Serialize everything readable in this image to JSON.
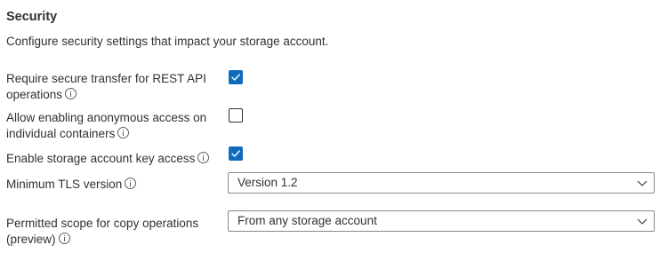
{
  "section": {
    "title": "Security",
    "description": "Configure security settings that impact your storage account."
  },
  "fields": {
    "secure_transfer": {
      "label": "Require secure transfer for REST API operations",
      "checked": true
    },
    "anonymous_access": {
      "label": "Allow enabling anonymous access on individual containers",
      "checked": false
    },
    "account_key_access": {
      "label": "Enable storage account key access",
      "checked": true
    },
    "min_tls": {
      "label": "Minimum TLS version",
      "selected": "Version 1.2"
    },
    "copy_scope": {
      "label": "Permitted scope for copy operations (preview)",
      "selected": "From any storage account"
    }
  },
  "icons": {
    "info": "info-icon",
    "checkmark": "checkmark-icon",
    "chevron": "chevron-down-icon"
  },
  "colors": {
    "accent": "#0f6cbd",
    "text": "#323130",
    "border": "#8a8886"
  }
}
